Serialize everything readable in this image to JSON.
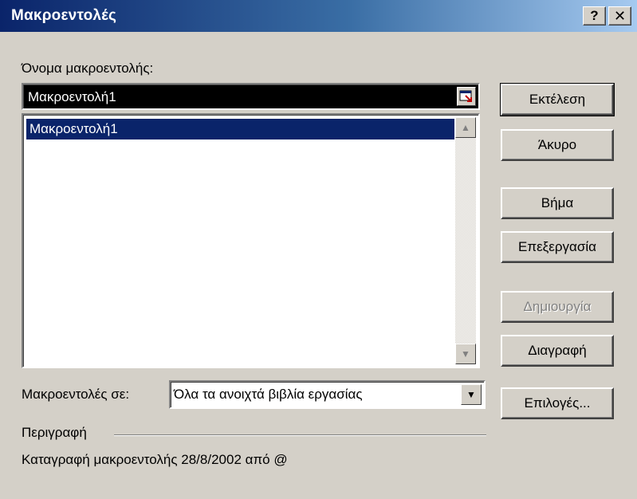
{
  "window": {
    "title": "Μακροεντολές",
    "help_button": "?",
    "close_button": "✕"
  },
  "name_label": "Όνομα μακροεντολής:",
  "name_value": "Μακροεντολή1",
  "macro_list": {
    "items": [
      "Μακροεντολή1"
    ],
    "selected_index": 0
  },
  "buttons": {
    "run": "Εκτέλεση",
    "cancel": "Άκυρο",
    "step": "Βήμα",
    "edit": "Επεξεργασία",
    "create": "Δημιουργία",
    "delete": "Διαγραφή",
    "options": "Επιλογές..."
  },
  "macros_in_label": "Μακροεντολές σε:",
  "macros_in_value": "Όλα τα ανοιχτά βιβλία εργασίας",
  "description_label": "Περιγραφή",
  "description_text": "Καταγραφή μακροεντολής 28/8/2002 από @",
  "icons": {
    "scroll_up": "triangle-up",
    "scroll_down": "triangle-down",
    "dropdown": "triangle-down",
    "collapse_dialog": "collapse-dialog-icon"
  }
}
